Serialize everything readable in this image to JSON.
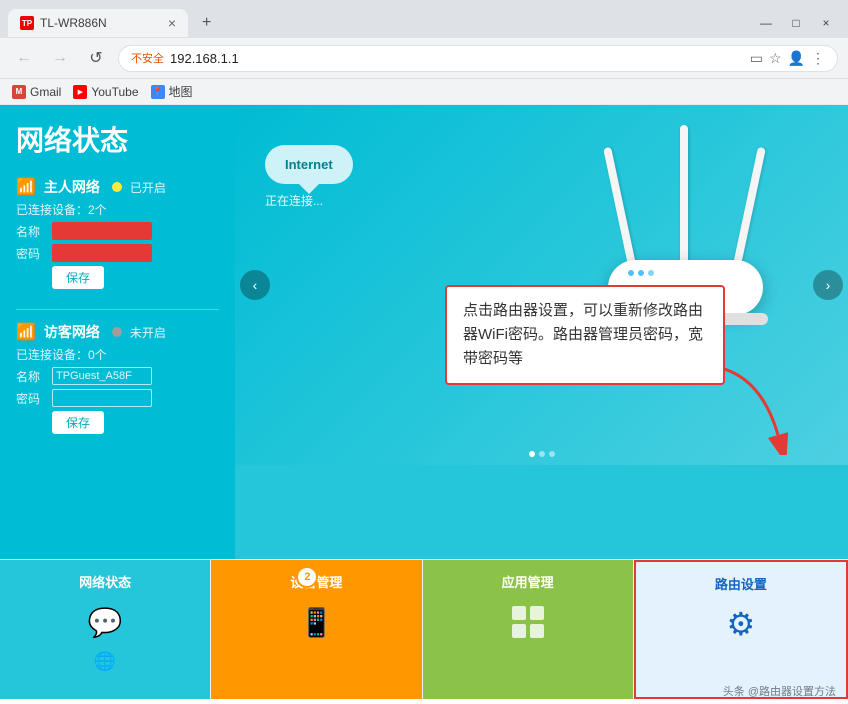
{
  "browser": {
    "tab": {
      "favicon_text": "TP",
      "title": "TL-WR886N",
      "close": "×"
    },
    "new_tab": "+",
    "win_controls": {
      "minimize": "—",
      "maximize": "□",
      "close": "×"
    },
    "nav": {
      "back": "←",
      "forward": "→",
      "refresh": "↺",
      "security": "不安全",
      "address": "192.168.1.1",
      "bookmark_icon": "☆",
      "cast_icon": "▭",
      "profile_icon": "👤",
      "menu_icon": "⋮"
    },
    "bookmarks": [
      {
        "name": "Gmail",
        "label": "Gmail",
        "color": "#DB4437"
      },
      {
        "name": "YouTube",
        "label": "YouTube",
        "color": "#FF0000"
      },
      {
        "name": "Maps",
        "label": "地图",
        "color": "#4285F4"
      }
    ]
  },
  "page": {
    "sidebar_title": "网络状态",
    "main_network": {
      "label": "主人网络",
      "status": "已开启",
      "devices": "已连接设备：2个",
      "name_label": "名称",
      "password_label": "密码",
      "save_btn": "保存"
    },
    "guest_network": {
      "label": "访客网络",
      "status": "未开启",
      "devices": "已连接设备：0个",
      "name_label": "名称",
      "name_value": "TPGuest_A58F",
      "password_label": "密码",
      "save_btn": "保存"
    },
    "cloud_label": "Internet",
    "connecting_text": "正在连接...",
    "tooltip": "点击路由器设置，可以重新修改路由器WiFi密码。路由器管理员密码，宽带密码等",
    "watermark": "头条 @路由器设置方法",
    "bottom_nav": [
      {
        "label": "网络状态",
        "icon": "💬",
        "bg": "teal",
        "active": false
      },
      {
        "label": "设备管理",
        "icon": "📱",
        "bg": "orange",
        "active": false,
        "badge": "2"
      },
      {
        "label": "应用管理",
        "icon": "⊞",
        "bg": "lightgreen",
        "active": false
      },
      {
        "label": "路由设置",
        "icon": "⚙",
        "bg": "lightblue",
        "active": true
      }
    ]
  }
}
